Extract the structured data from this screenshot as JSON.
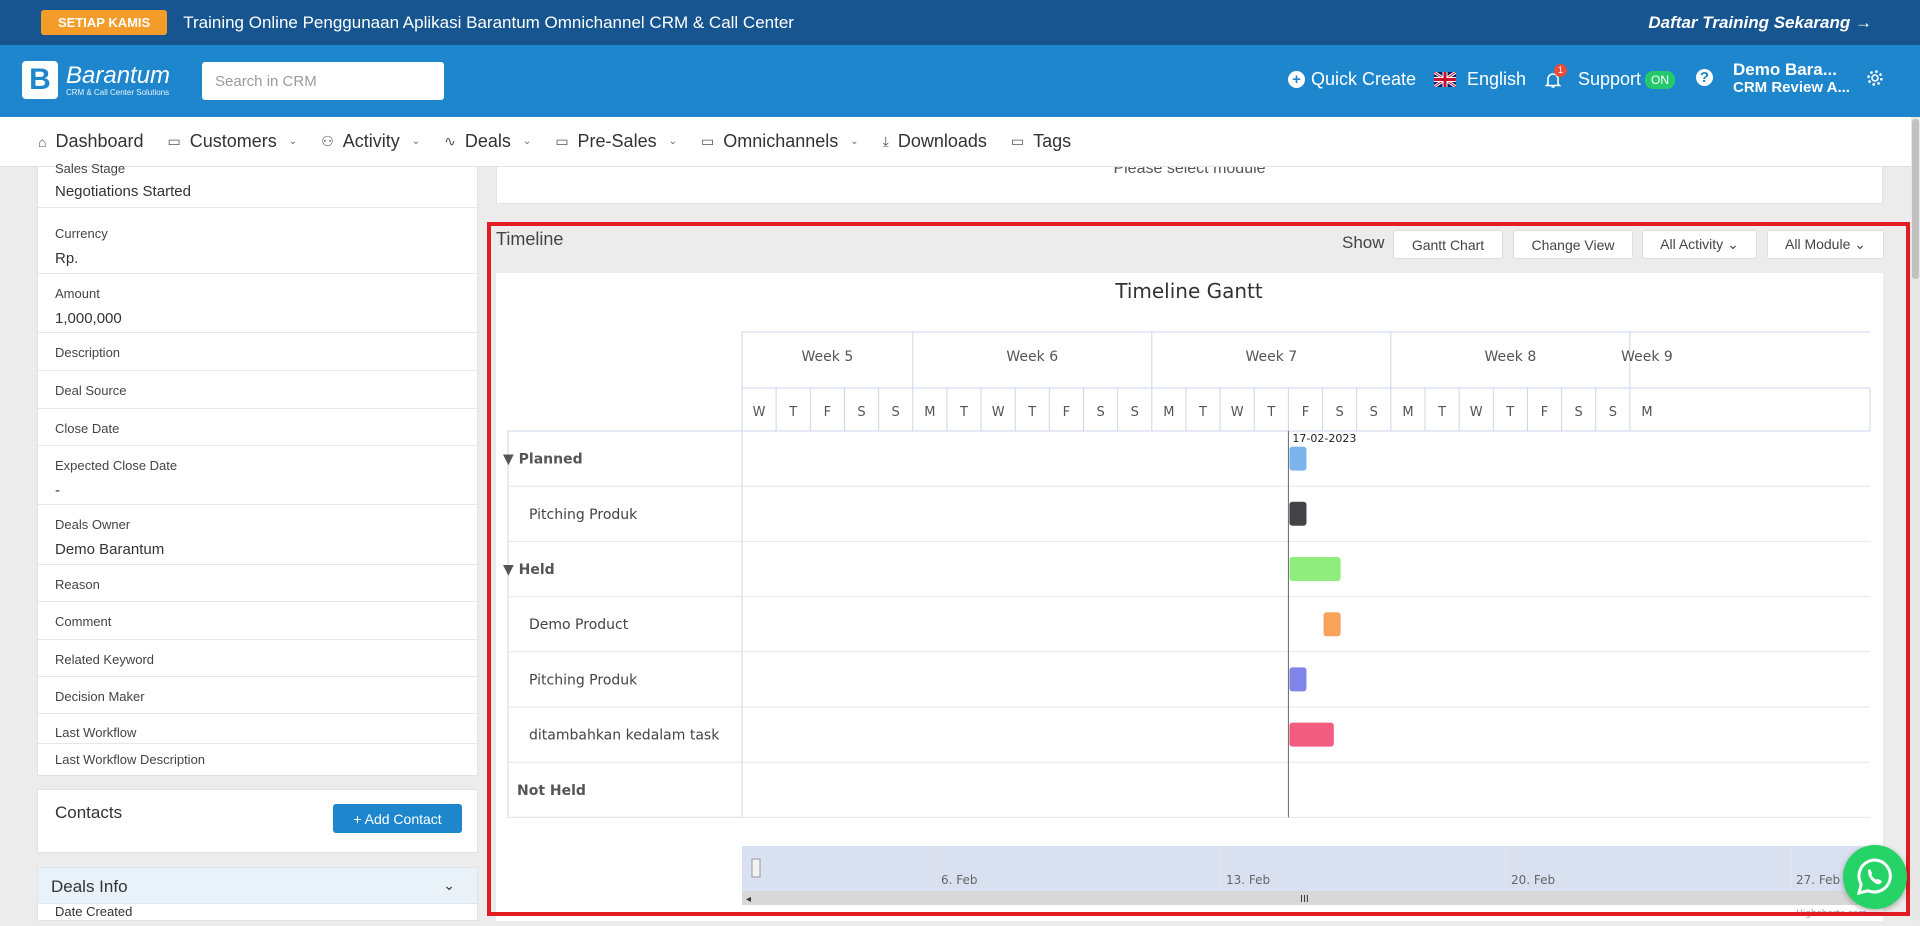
{
  "promo": {
    "badge": "SETIAP KAMIS",
    "text": "Training Online Penggunaan Aplikasi Barantum Omnichannel CRM & Call Center",
    "cta": "Daftar Training Sekarang"
  },
  "header": {
    "logo_name": "Barantum",
    "logo_tagline": "CRM & Call Center Solutions",
    "search_placeholder": "Search in CRM",
    "quick_create": "Quick Create",
    "language": "English",
    "notif_count": "1",
    "support": "Support",
    "support_status": "ON",
    "user_name": "Demo Bara...",
    "user_role": "CRM Review A..."
  },
  "nav": [
    {
      "label": "Dashboard",
      "icon": "home-icon"
    },
    {
      "label": "Customers",
      "icon": "folder-icon"
    },
    {
      "label": "Activity",
      "icon": "users-icon"
    },
    {
      "label": "Deals",
      "icon": "pulse-icon"
    },
    {
      "label": "Pre-Sales",
      "icon": "folder-icon"
    },
    {
      "label": "Omnichannels",
      "icon": "folder-icon"
    },
    {
      "label": "Downloads",
      "icon": "download-icon"
    },
    {
      "label": "Tags",
      "icon": "folder-icon"
    }
  ],
  "details": {
    "sales_stage": {
      "label": "Sales Stage",
      "value": "Negotiations Started"
    },
    "currency": {
      "label": "Currency",
      "value": "Rp."
    },
    "amount": {
      "label": "Amount",
      "value": "1,000,000"
    },
    "description": {
      "label": "Description"
    },
    "deal_source": {
      "label": "Deal Source"
    },
    "close_date": {
      "label": "Close Date"
    },
    "expected_close_date": {
      "label": "Expected Close Date",
      "value": "-"
    },
    "deals_owner": {
      "label": "Deals Owner",
      "value": "Demo Barantum"
    },
    "reason": {
      "label": "Reason"
    },
    "comment": {
      "label": "Comment"
    },
    "related_keyword": {
      "label": "Related Keyword"
    },
    "decision_maker": {
      "label": "Decision Maker"
    },
    "last_workflow": {
      "label": "Last Workflow"
    },
    "last_workflow_description": {
      "label": "Last Workflow Description"
    }
  },
  "contacts": {
    "title": "Contacts",
    "add_button": "+ Add Contact"
  },
  "deals_info": {
    "title": "Deals Info",
    "date_created_label": "Date Created"
  },
  "upper_card": {
    "text": "Please select module"
  },
  "timeline": {
    "title": "Timeline",
    "show_label": "Show",
    "buttons": [
      "Gantt Chart",
      "Change View",
      "All Activity",
      "All Module"
    ]
  },
  "chart_data": {
    "type": "gantt",
    "title": "Timeline Gantt",
    "weeks": [
      {
        "label": "Week 5",
        "days": [
          "W",
          "T",
          "F",
          "S",
          "S"
        ]
      },
      {
        "label": "Week 6",
        "days": [
          "M",
          "T",
          "W",
          "T",
          "F",
          "S",
          "S"
        ]
      },
      {
        "label": "Week 7",
        "days": [
          "M",
          "T",
          "W",
          "T",
          "F",
          "S",
          "S"
        ]
      },
      {
        "label": "Week 8",
        "days": [
          "M",
          "T",
          "W",
          "T",
          "F",
          "S",
          "S"
        ]
      },
      {
        "label": "Week 9",
        "days": [
          "M"
        ]
      }
    ],
    "current_date": "17-02-2023",
    "current_day_index": 16,
    "rows": [
      {
        "label": "Planned",
        "group": true,
        "collapsible": true,
        "start": 16,
        "end": 16.5,
        "color": "#7cb5ec"
      },
      {
        "label": "Pitching Produk",
        "start": 16,
        "end": 16.5,
        "color": "#434348"
      },
      {
        "label": "Held",
        "group": true,
        "collapsible": true,
        "start": 16,
        "end": 17.5,
        "color": "#90ed7d"
      },
      {
        "label": "Demo Product",
        "start": 17,
        "end": 17.5,
        "color": "#f7a35c"
      },
      {
        "label": "Pitching Produk",
        "start": 16,
        "end": 16.5,
        "color": "#8085e9"
      },
      {
        "label": "ditambahkan kedalam task",
        "start": 16,
        "end": 17.3,
        "color": "#f15c80"
      },
      {
        "label": "Not Held",
        "group": true
      }
    ],
    "navigator_labels": [
      "6. Feb",
      "13. Feb",
      "20. Feb",
      "27. Feb"
    ],
    "credit": "Highcharts.com"
  }
}
